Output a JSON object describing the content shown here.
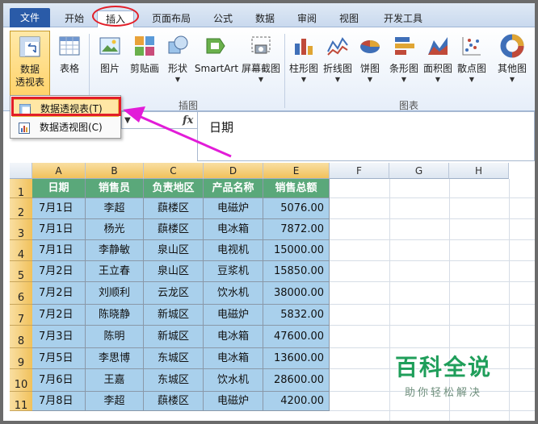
{
  "tabs": [
    {
      "label": "文件"
    },
    {
      "label": "开始"
    },
    {
      "label": "插入"
    },
    {
      "label": "页面布局"
    },
    {
      "label": "公式"
    },
    {
      "label": "数据"
    },
    {
      "label": "审阅"
    },
    {
      "label": "视图"
    },
    {
      "label": "开发工具"
    }
  ],
  "ribbon": {
    "pivot_table_line1": "数据",
    "pivot_table_line2": "透视表",
    "table": "表格",
    "picture": "图片",
    "clipart": "剪贴画",
    "shapes": "形状",
    "smartart": "SmartArt",
    "screenshot": "屏幕截图",
    "column_chart": "柱形图",
    "line_chart": "折线图",
    "pie_chart": "饼图",
    "bar_chart": "条形图",
    "area_chart": "面积图",
    "scatter_chart": "散点图",
    "other_chart": "其他图",
    "group_illustrations": "插图",
    "group_charts": "图表"
  },
  "menu": {
    "item1": "数据透视表(T)",
    "item2": "数据透视图(C)"
  },
  "formula_bar": {
    "fx": "fx",
    "content": "日期"
  },
  "columns": [
    "A",
    "B",
    "C",
    "D",
    "E",
    "F",
    "G",
    "H"
  ],
  "table": {
    "headers": [
      "日期",
      "销售员",
      "负责地区",
      "产品名称",
      "销售总额"
    ],
    "rows": [
      [
        "7月1日",
        "李超",
        "蕻楼区",
        "电磁炉",
        "5076.00"
      ],
      [
        "7月1日",
        "杨光",
        "蕻楼区",
        "电冰箱",
        "7872.00"
      ],
      [
        "7月1日",
        "李静敏",
        "泉山区",
        "电视机",
        "15000.00"
      ],
      [
        "7月2日",
        "王立春",
        "泉山区",
        "豆浆机",
        "15850.00"
      ],
      [
        "7月2日",
        "刘顺利",
        "云龙区",
        "饮水机",
        "38000.00"
      ],
      [
        "7月2日",
        "陈晓静",
        "新城区",
        "电磁炉",
        "5832.00"
      ],
      [
        "7月3日",
        "陈明",
        "新城区",
        "电冰箱",
        "47600.00"
      ],
      [
        "7月5日",
        "李思博",
        "东城区",
        "电冰箱",
        "13600.00"
      ],
      [
        "7月6日",
        "王嘉",
        "东城区",
        "饮水机",
        "28600.00"
      ],
      [
        "7月8日",
        "李超",
        "蕻楼区",
        "电磁炉",
        "4200.00"
      ]
    ]
  },
  "row_numbers": [
    "1",
    "2",
    "3",
    "4",
    "5",
    "6",
    "7",
    "8",
    "9",
    "10",
    "11"
  ],
  "watermark": {
    "title": "百科全说",
    "subtitle": "助你轻松解决"
  },
  "colors": {
    "header_green": "#5aa87a",
    "data_blue": "#a9d0ec",
    "highlight_red": "#e21e28",
    "arrow_magenta": "#e21cd8"
  }
}
